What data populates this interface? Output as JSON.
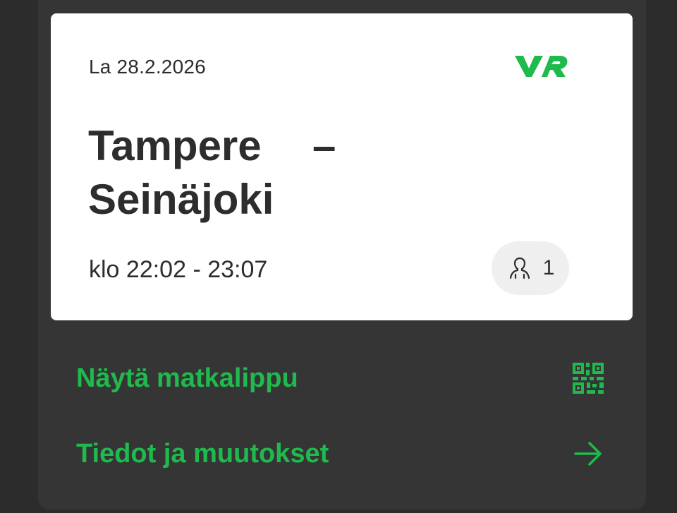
{
  "ticket": {
    "date": "La 28.2.2026",
    "logo_text": "VR",
    "route_from": "Tampere",
    "route_dash": "–",
    "route_to": "Seinäjoki",
    "time": "klo 22:02 - 23:07",
    "passenger_count": "1"
  },
  "actions": {
    "show_ticket_label": "Näytä matkalippu",
    "details_label": "Tiedot ja muutokset"
  },
  "icons": {
    "logo": "vr-logo",
    "passenger": "person-icon",
    "show_ticket": "qr-code-icon",
    "details": "arrow-right-icon"
  },
  "colors": {
    "accent_green": "#1fba4d",
    "background": "#2c2c2c",
    "panel": "#353535",
    "card": "#ffffff",
    "pill": "#efefef",
    "text": "#2d2d2d"
  }
}
